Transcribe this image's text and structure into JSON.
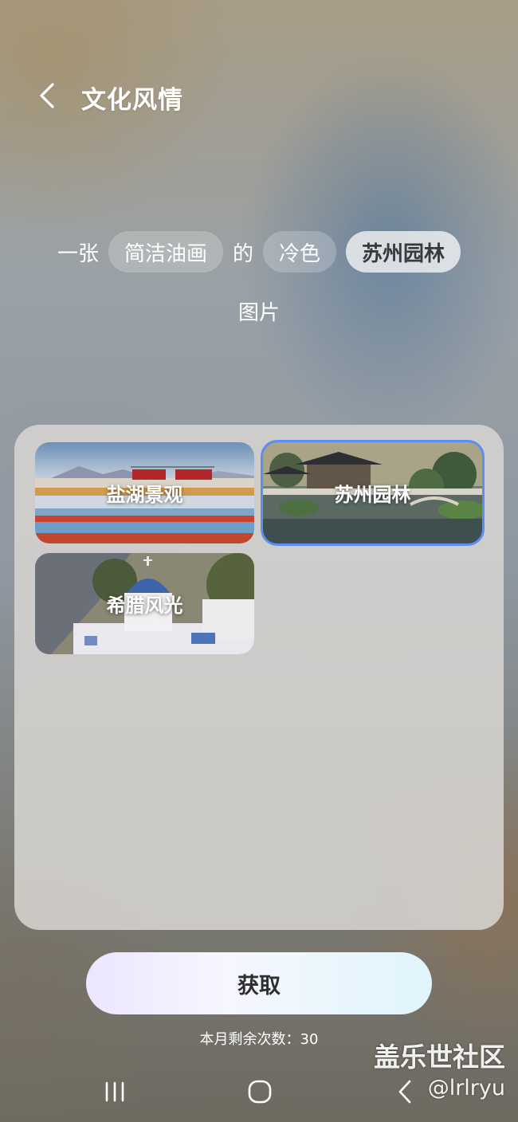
{
  "header": {
    "title": "文化风情",
    "back_icon": "chevron-left-icon"
  },
  "prompt": {
    "prefix": "一张",
    "style_chip": "简洁油画",
    "connector": "的",
    "tone_chip": "冷色",
    "subject_chip": "苏州园林",
    "suffix": "图片"
  },
  "gallery": {
    "items": [
      {
        "label": "盐湖景观",
        "selected": false
      },
      {
        "label": "苏州园林",
        "selected": true
      },
      {
        "label": "希腊风光",
        "selected": false
      }
    ]
  },
  "action": {
    "get_label": "获取",
    "remaining": "本月剩余次数：30"
  },
  "watermark": {
    "line1": "盖乐世社区",
    "line2": "@lrlryu"
  },
  "nav": {
    "recents_icon": "recents-icon",
    "home_icon": "home-icon",
    "back_icon": "back-icon"
  },
  "colors": {
    "accent": "#5b8ef0",
    "selected_chip_bg": "#ffffffb8"
  }
}
